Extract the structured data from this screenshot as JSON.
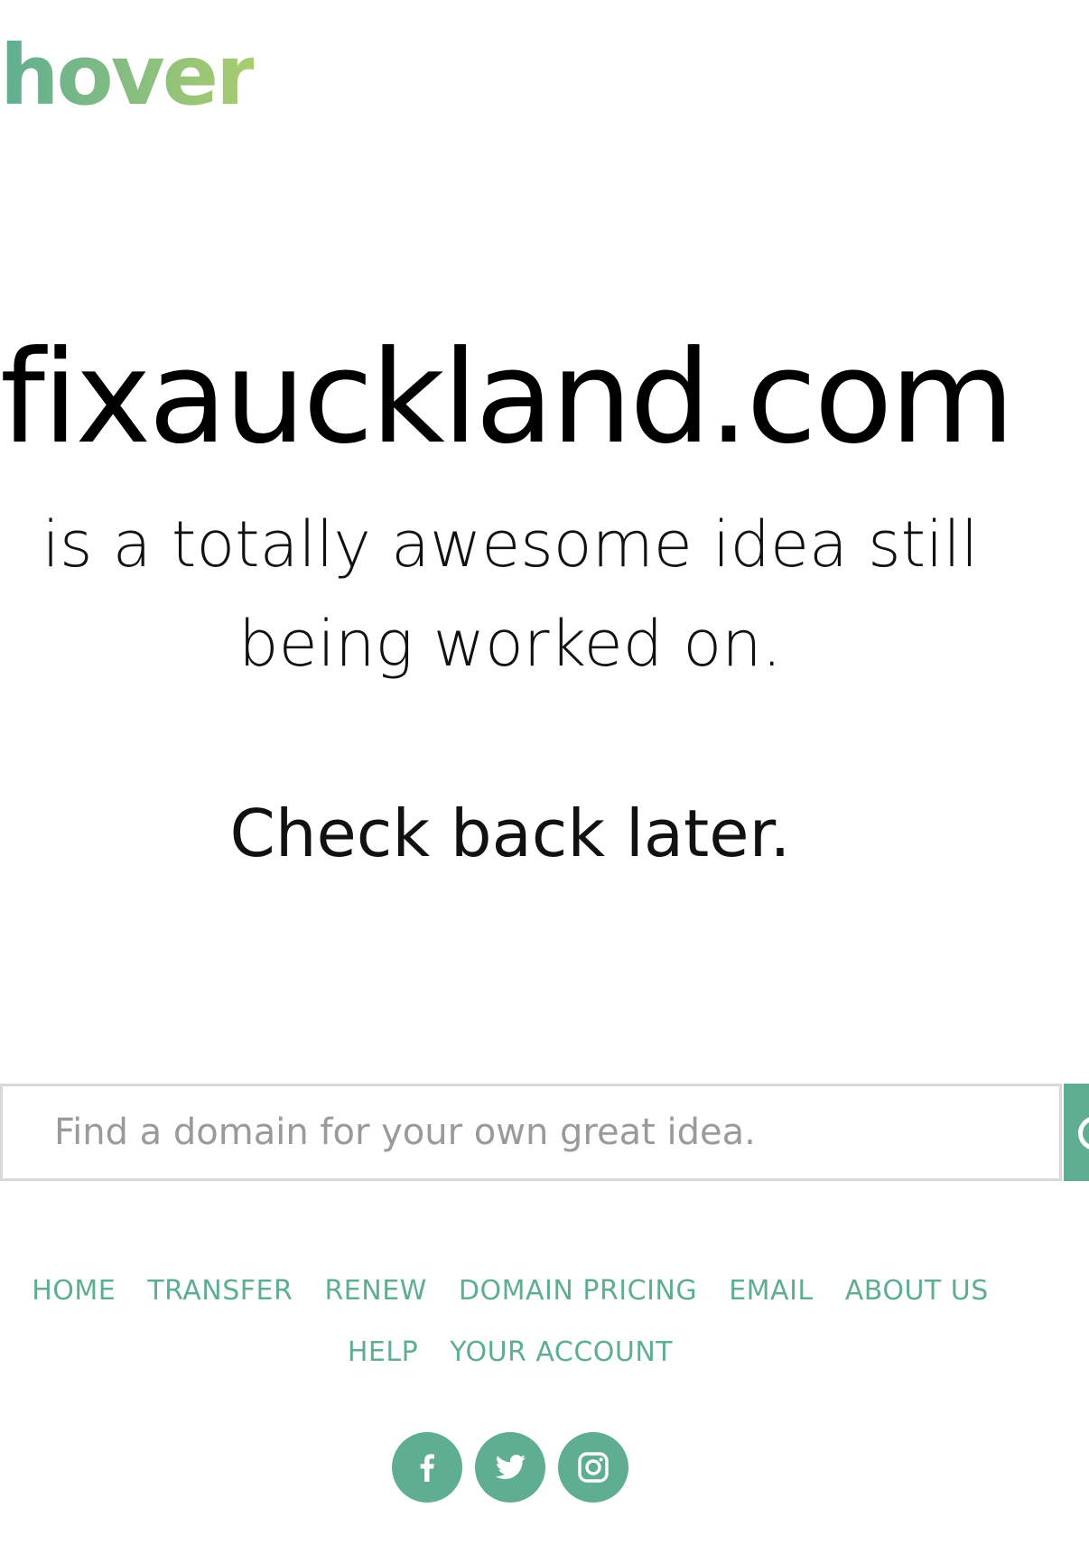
{
  "logo": {
    "text": "hover"
  },
  "hero": {
    "domain": "fixauckland.com",
    "tagline_line1": "is a totally awesome idea still",
    "tagline_line2": "being worked on.",
    "check_back": "Check back later."
  },
  "search": {
    "placeholder": "Find a domain for your own great idea.",
    "value": "",
    "button_icon": "search-icon"
  },
  "nav": {
    "row1": [
      "HOME",
      "TRANSFER",
      "RENEW",
      "DOMAIN PRICING",
      "EMAIL",
      "ABOUT US"
    ],
    "row2": [
      "HELP",
      "YOUR ACCOUNT"
    ]
  },
  "social": [
    "facebook-icon",
    "twitter-icon",
    "instagram-icon"
  ],
  "colors": {
    "accent": "#5fae92",
    "logo_gradient_end": "#a9cd6e",
    "text": "#000000",
    "placeholder": "#9a9a9a",
    "border": "#d9d9d9"
  }
}
